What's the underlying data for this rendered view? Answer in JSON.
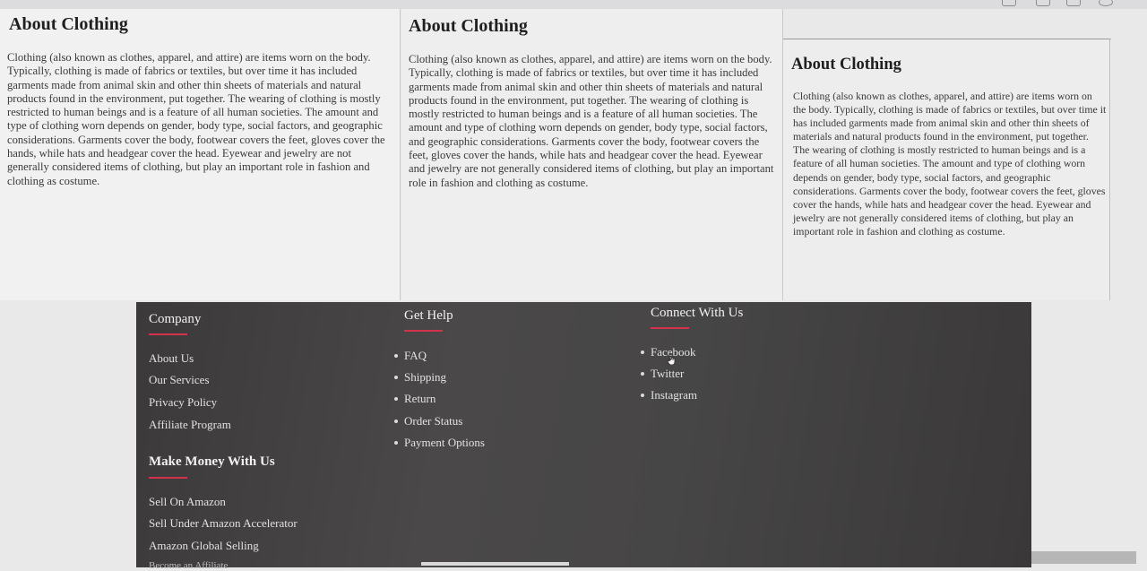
{
  "articles": [
    {
      "title": "About Clothing",
      "body": "Clothing (also known as clothes, apparel, and attire) are items worn on the body. Typically, clothing is made of fabrics or textiles, but over time it has included garments made from animal skin and other thin sheets of materials and natural products found in the environment, put together. The wearing of clothing is mostly restricted to human beings and is a feature of all human societies. The amount and type of clothing worn depends on gender, body type, social factors, and geographic considerations. Garments cover the body, footwear covers the feet, gloves cover the hands, while hats and headgear cover the head. Eyewear and jewelry are not generally considered items of clothing, but play an important role in fashion and clothing as costume."
    },
    {
      "title": "About Clothing",
      "body": "Clothing (also known as clothes, apparel, and attire) are items worn on the body. Typically, clothing is made of fabrics or textiles, but over time it has included garments made from animal skin and other thin sheets of materials and natural products found in the environment, put together. The wearing of clothing is mostly restricted to human beings and is a feature of all human societies. The amount and type of clothing worn depends on gender, body type, social factors, and geographic considerations. Garments cover the body, footwear covers the feet, gloves cover the hands, while hats and headgear cover the head. Eyewear and jewelry are not generally considered items of clothing, but play an important role in fashion and clothing as costume."
    },
    {
      "title": "About Clothing",
      "body": "Clothing (also known as clothes, apparel, and attire) are items worn on the body. Typically, clothing is made of fabrics or textiles, but over time it has included garments made from animal skin and other thin sheets of materials and natural products found in the environment, put together. The wearing of clothing is mostly restricted to human beings and is a feature of all human societies. The amount and type of clothing worn depends on gender, body type, social factors, and geographic considerations. Garments cover the body, footwear covers the feet, gloves cover the hands, while hats and headgear cover the head. Eyewear and jewelry are not generally considered items of clothing, but play an important role in fashion and clothing as costume."
    }
  ],
  "footer": {
    "company": {
      "heading": "Company",
      "links": [
        "About Us",
        "Our Services",
        "Privacy Policy",
        "Affiliate Program"
      ]
    },
    "get_help": {
      "heading": "Get Help",
      "links": [
        "FAQ",
        "Shipping",
        "Return",
        "Order Status",
        "Payment Options"
      ]
    },
    "connect": {
      "heading": "Connect With Us",
      "links": [
        "Facebook",
        "Twitter",
        "Instagram"
      ]
    },
    "make_money": {
      "heading": "Make Money With Us",
      "links": [
        "Sell On Amazon",
        "Sell Under Amazon Accelerator",
        "Amazon Global Selling"
      ]
    },
    "cut_off_text": "Become an Affiliate"
  },
  "colors": {
    "accent_underline": "#d3334a",
    "footer_bg": "#444242",
    "page_bg": "#e9e9ea"
  }
}
